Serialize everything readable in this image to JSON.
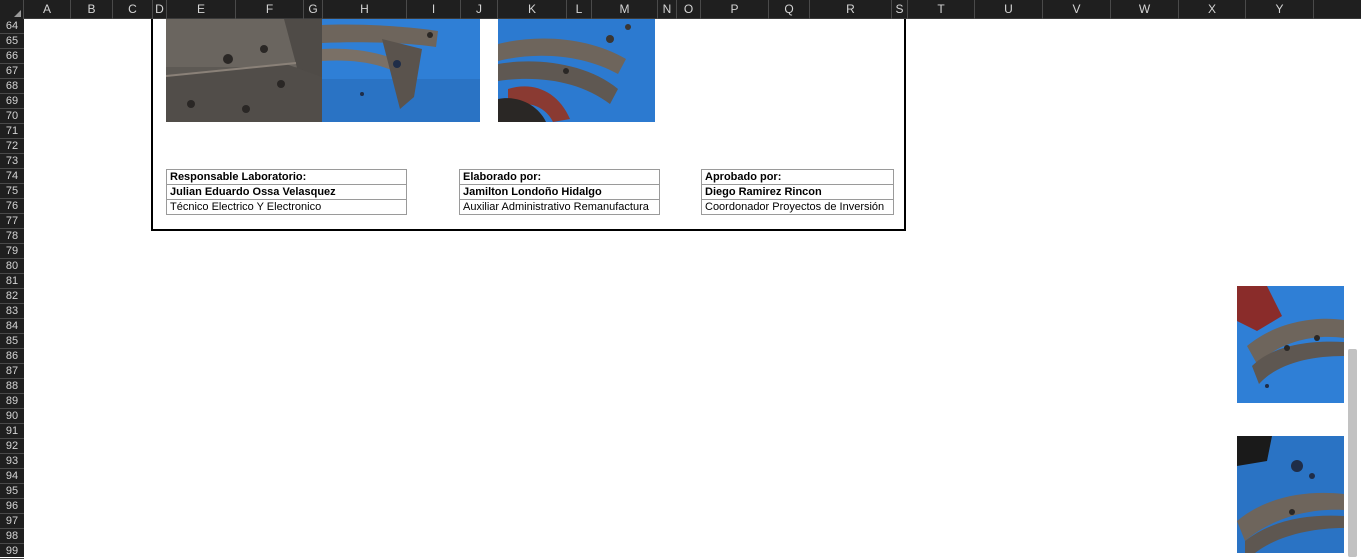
{
  "columns": [
    "A",
    "B",
    "C",
    "D",
    "E",
    "F",
    "G",
    "H",
    "I",
    "J",
    "K",
    "L",
    "M",
    "N",
    "O",
    "P",
    "Q",
    "R",
    "S",
    "T",
    "U",
    "V",
    "W",
    "X",
    "Y"
  ],
  "rows": [
    "64",
    "65",
    "66",
    "67",
    "68",
    "69",
    "70",
    "71",
    "72",
    "73",
    "74",
    "75",
    "76",
    "77",
    "78",
    "79",
    "80",
    "81",
    "82",
    "83",
    "84",
    "85",
    "86",
    "87",
    "88",
    "89",
    "90",
    "91",
    "92",
    "93",
    "94",
    "95",
    "96",
    "97",
    "98",
    "99"
  ],
  "signatures": [
    {
      "role": "Responsable Laboratorio:",
      "name": "Julian Eduardo Ossa Velasquez",
      "title": "Técnico Electrico Y Electronico"
    },
    {
      "role": "Elaborado por:",
      "name": "Jamilton Londoño Hidalgo",
      "title": "Auxiliar Administrativo Remanufactura"
    },
    {
      "role": "Aprobado por:",
      "name": "Diego Ramirez Rincon",
      "title": "Coordonador Proyectos de Inversión"
    }
  ],
  "colors": {
    "header_bg": "#1f1f1f",
    "header_text": "#d4d4d4",
    "photo_blue": "#2f7fd6",
    "brake_shoe": "#6e655c"
  },
  "icons": [
    "select-all-triangle-icon"
  ]
}
